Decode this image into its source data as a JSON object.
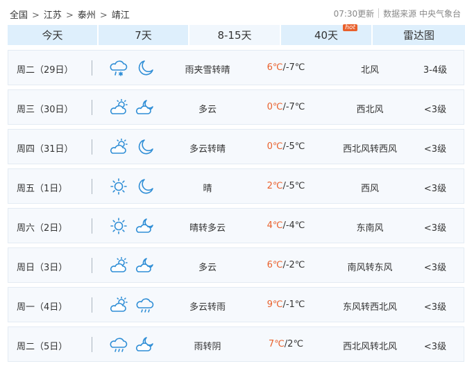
{
  "breadcrumb": {
    "items": [
      "全国",
      "江苏",
      "泰州",
      "靖江"
    ],
    "separator": ">"
  },
  "update": {
    "time": "07:30更新",
    "source": "数据来源 中央气象台"
  },
  "tabs": [
    {
      "label": "今天",
      "active": false
    },
    {
      "label": "7天",
      "active": false
    },
    {
      "label": "8-15天",
      "active": true
    },
    {
      "label": "40天",
      "active": false,
      "badge": "hot"
    },
    {
      "label": "雷达图",
      "active": false
    }
  ],
  "colors": {
    "accent": "#e9602c",
    "icon": "#2f8ed6",
    "tab_bg": "#deeffc",
    "row_bg": "#f6f9fd"
  },
  "forecast": [
    {
      "day": "周二（29日）",
      "day_icon": "sleet-icon",
      "night_icon": "moon-icon",
      "weather": "雨夹雪转晴",
      "high": "6℃",
      "low": "/-7℃",
      "wind": "北风",
      "level": "3-4级"
    },
    {
      "day": "周三（30日）",
      "day_icon": "partly-cloudy-day-icon",
      "night_icon": "partly-cloudy-night-icon",
      "weather": "多云",
      "high": "0℃",
      "low": "/-7℃",
      "wind": "西北风",
      "level": "<3级"
    },
    {
      "day": "周四（31日）",
      "day_icon": "partly-cloudy-day-icon",
      "night_icon": "moon-icon",
      "weather": "多云转晴",
      "high": "0℃",
      "low": "/-5℃",
      "wind": "西北风转西风",
      "level": "<3级"
    },
    {
      "day": "周五（1日）",
      "day_icon": "sun-icon",
      "night_icon": "moon-icon",
      "weather": "晴",
      "high": "2℃",
      "low": "/-5℃",
      "wind": "西风",
      "level": "<3级"
    },
    {
      "day": "周六（2日）",
      "day_icon": "sun-icon",
      "night_icon": "partly-cloudy-night-icon",
      "weather": "晴转多云",
      "high": "4℃",
      "low": "/-4℃",
      "wind": "东南风",
      "level": "<3级"
    },
    {
      "day": "周日（3日）",
      "day_icon": "partly-cloudy-day-icon",
      "night_icon": "partly-cloudy-night-icon",
      "weather": "多云",
      "high": "6℃",
      "low": "/-2℃",
      "wind": "南风转东风",
      "level": "<3级"
    },
    {
      "day": "周一（4日）",
      "day_icon": "partly-cloudy-day-icon",
      "night_icon": "rain-icon",
      "weather": "多云转雨",
      "high": "9℃",
      "low": "/-1℃",
      "wind": "东风转西北风",
      "level": "<3级"
    },
    {
      "day": "周二（5日）",
      "day_icon": "rain-icon",
      "night_icon": "partly-cloudy-night-icon",
      "weather": "雨转阴",
      "high": "7℃",
      "low": "/2℃",
      "wind": "西北风转北风",
      "level": "<3级"
    }
  ]
}
